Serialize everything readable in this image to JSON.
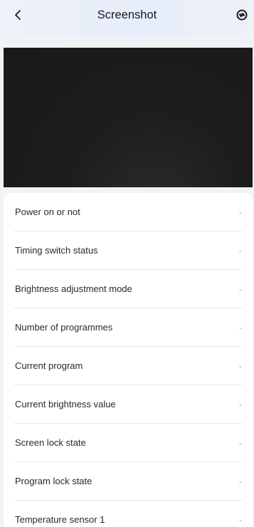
{
  "header": {
    "title": "Screenshot",
    "back_icon": "chevron-left-icon",
    "action_icon": "sync-icon"
  },
  "status_list": [
    {
      "label": "Power on or not",
      "value": "-"
    },
    {
      "label": "Timing switch status",
      "value": "-"
    },
    {
      "label": "Brightness adjustment mode",
      "value": "-"
    },
    {
      "label": "Number of programmes",
      "value": "-"
    },
    {
      "label": "Current program",
      "value": "-"
    },
    {
      "label": "Current brightness value",
      "value": "-"
    },
    {
      "label": "Screen lock state",
      "value": "-"
    },
    {
      "label": "Program lock state",
      "value": "-"
    },
    {
      "label": "Temperature sensor 1",
      "value": "-"
    }
  ],
  "colors": {
    "preview_background": "#1a1a1a",
    "card_background": "#ffffff",
    "page_background": "#f2f3f5"
  }
}
